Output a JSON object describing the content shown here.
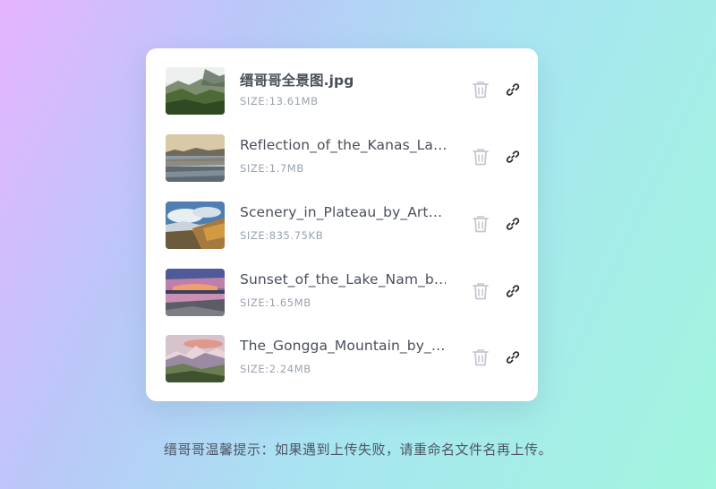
{
  "files": [
    {
      "name": "缙哥哥全景图.jpg",
      "size": "SIZE:13.61MB",
      "thumb_icon": "image-thumbnail-icon",
      "delete_icon": "trash-icon",
      "link_icon": "link-icon"
    },
    {
      "name": "Reflection_of_the_Kanas_La…",
      "size": "SIZE:1.7MB",
      "thumb_icon": "image-thumbnail-icon",
      "delete_icon": "trash-icon",
      "link_icon": "link-icon"
    },
    {
      "name": "Scenery_in_Plateau_by_Art…",
      "size": "SIZE:835.75KB",
      "thumb_icon": "image-thumbnail-icon",
      "delete_icon": "trash-icon",
      "link_icon": "link-icon"
    },
    {
      "name": "Sunset_of_the_Lake_Nam_b…",
      "size": "SIZE:1.65MB",
      "thumb_icon": "image-thumbnail-icon",
      "delete_icon": "trash-icon",
      "link_icon": "link-icon"
    },
    {
      "name": "The_Gongga_Mountain_by_…",
      "size": "SIZE:2.24MB",
      "thumb_icon": "image-thumbnail-icon",
      "delete_icon": "trash-icon",
      "link_icon": "link-icon"
    }
  ],
  "hint": "缙哥哥温馨提示：如果遇到上传失败，请重命名文件名再上传。",
  "colors": {
    "text_primary": "#4a4f5a",
    "text_secondary": "#9aa2ae",
    "trash_icon": "#c4c9d1",
    "link_icon": "#2a2d33"
  }
}
